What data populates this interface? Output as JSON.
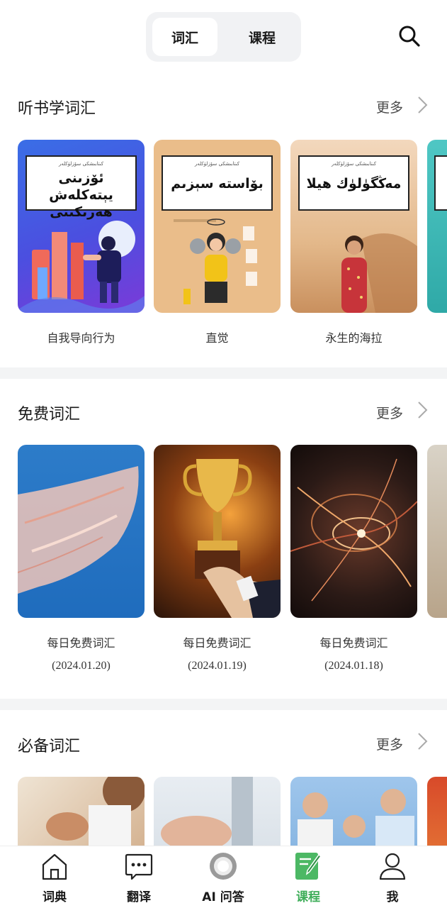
{
  "top_tabs": {
    "vocab": "词汇",
    "course": "课程"
  },
  "sections": [
    {
      "title": "听书学词汇",
      "more": "更多",
      "cards": [
        {
          "caption": "自我导向行为",
          "cover_small": "كىتابىشكى سۆزلۈكلەر",
          "cover_title": "ئۆزىنى يېتەكلەش هەرىكىتى"
        },
        {
          "caption": "直觉",
          "cover_small": "كىتابىشكى سۆزلۈكلەر",
          "cover_title": "بۆاستە سېزىم"
        },
        {
          "caption": "永生的海拉",
          "cover_small": "كىتابىشكى سۆزلۈكلەر",
          "cover_title": "مەڭگۈلۈك هيلا"
        }
      ]
    },
    {
      "title": "免费词汇",
      "more": "更多",
      "cards": [
        {
          "caption": "每日免费词汇",
          "date": "(2024.01.20)"
        },
        {
          "caption": "每日免费词汇",
          "date": "(2024.01.19)"
        },
        {
          "caption": "每日免费词汇",
          "date": "(2024.01.18)"
        }
      ]
    },
    {
      "title": "必备词汇",
      "more": "更多"
    }
  ],
  "bottom_nav": [
    {
      "label": "词典",
      "icon": "home-icon"
    },
    {
      "label": "翻译",
      "icon": "chat-bubble-icon"
    },
    {
      "label": "AI 问答",
      "icon": "ai-ring-icon"
    },
    {
      "label": "课程",
      "icon": "notebook-pen-icon",
      "active": true
    },
    {
      "label": "我",
      "icon": "user-icon"
    }
  ],
  "colors": {
    "active_green": "#3fae5a",
    "divider": "#f3f4f5"
  }
}
